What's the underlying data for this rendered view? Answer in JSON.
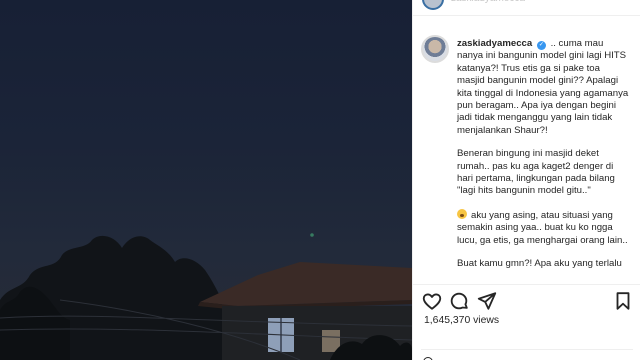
{
  "post": {
    "username": "zaskiadyamecca",
    "caption_paragraphs": [
      ".. cuma mau nanya ini bangunin model gini lagi HITS katanya?! Trus etis ga si pake toa masjid bangunin model gini?? Apalagi kita tinggal di Indonesia yang agamanya pun beragam.. Apa iya dengan begini jadi tidak menganggu yang lain tidak menjalankan Shaur?!",
      "Beneran bingung ini masjid deket rumah.. pas ku aga kaget2 denger di hari pertama, lingkungan pada bilang \"lagi hits bangunin model gitu..\"",
      "aku yang asing, atau situasi yang semakin asing yaa.. buat ku ko ngga lucu, ga etis, ga menghargai orang lain..",
      "Buat kamu gmn?! Apa aku yang terlalu"
    ],
    "views": "1,645,370 views"
  },
  "icons": {
    "verified": "verified-badge-icon",
    "emoji": "worried-face-emoji",
    "like": "heart-icon",
    "comment": "comment-bubble-icon",
    "share": "paper-plane-icon",
    "save": "bookmark-icon"
  },
  "colors": {
    "verified_blue": "#3897f0",
    "text": "#262626",
    "night_sky": "#1b2438"
  }
}
